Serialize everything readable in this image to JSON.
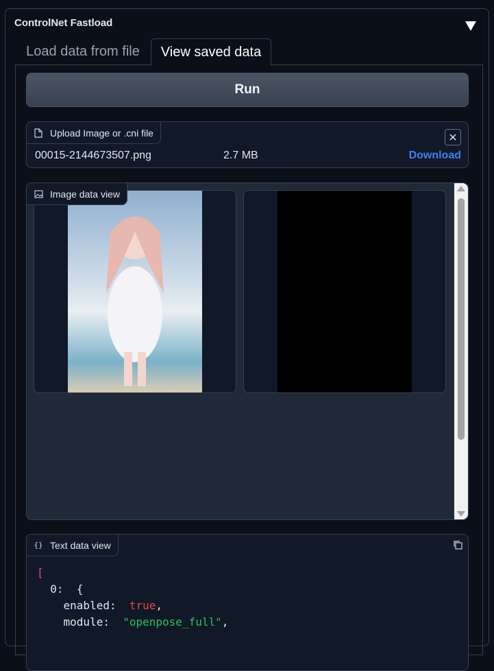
{
  "accordion": {
    "title": "ControlNet Fastload"
  },
  "tabs": [
    {
      "label": "Load data from file"
    },
    {
      "label": "View saved data"
    }
  ],
  "run_button": {
    "label": "Run"
  },
  "upload": {
    "label": "Upload Image or .cni file",
    "file_name": "00015-2144673507.png",
    "file_size": "2.7 MB",
    "download_label": "Download"
  },
  "gallery": {
    "label": "Image data view"
  },
  "text_view": {
    "label": "Text data view",
    "lines": {
      "open": "[",
      "key0": "0:",
      "brace": "{",
      "enabled_key": "enabled:",
      "enabled_val": "true",
      "module_key": "module:",
      "module_val": "\"openpose_full\""
    }
  },
  "colors": {
    "accent_link": "#3b82f6",
    "bool": "#ef4444",
    "string": "#22c55e",
    "bracket": "#ec4899"
  }
}
